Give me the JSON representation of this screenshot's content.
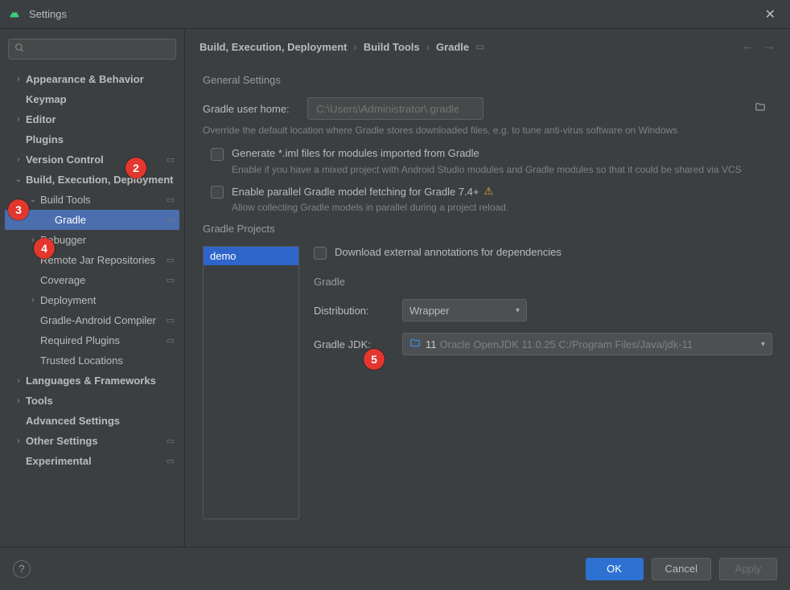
{
  "window": {
    "title": "Settings"
  },
  "search": {
    "placeholder": ""
  },
  "sidebar": {
    "items": [
      {
        "label": "Appearance & Behavior",
        "expandable": true,
        "expanded": false,
        "bold": true,
        "indent": 0
      },
      {
        "label": "Keymap",
        "expandable": false,
        "bold": true,
        "indent": 0
      },
      {
        "label": "Editor",
        "expandable": true,
        "expanded": false,
        "bold": true,
        "indent": 0
      },
      {
        "label": "Plugins",
        "expandable": false,
        "bold": true,
        "indent": 0
      },
      {
        "label": "Version Control",
        "expandable": true,
        "expanded": false,
        "bold": true,
        "indent": 0,
        "proj": true
      },
      {
        "label": "Build, Execution, Deployment",
        "expandable": true,
        "expanded": true,
        "bold": true,
        "indent": 0
      },
      {
        "label": "Build Tools",
        "expandable": true,
        "expanded": true,
        "bold": false,
        "indent": 1,
        "proj": true
      },
      {
        "label": "Gradle",
        "expandable": false,
        "bold": false,
        "indent": 2,
        "proj": true,
        "selected": true
      },
      {
        "label": "Debugger",
        "expandable": true,
        "expanded": false,
        "bold": false,
        "indent": 1
      },
      {
        "label": "Remote Jar Repositories",
        "expandable": false,
        "bold": false,
        "indent": 1,
        "proj": true
      },
      {
        "label": "Coverage",
        "expandable": false,
        "bold": false,
        "indent": 1,
        "proj": true
      },
      {
        "label": "Deployment",
        "expandable": true,
        "expanded": false,
        "bold": false,
        "indent": 1
      },
      {
        "label": "Gradle-Android Compiler",
        "expandable": false,
        "bold": false,
        "indent": 1,
        "proj": true
      },
      {
        "label": "Required Plugins",
        "expandable": false,
        "bold": false,
        "indent": 1,
        "proj": true
      },
      {
        "label": "Trusted Locations",
        "expandable": false,
        "bold": false,
        "indent": 1
      },
      {
        "label": "Languages & Frameworks",
        "expandable": true,
        "expanded": false,
        "bold": true,
        "indent": 0
      },
      {
        "label": "Tools",
        "expandable": true,
        "expanded": false,
        "bold": true,
        "indent": 0
      },
      {
        "label": "Advanced Settings",
        "expandable": false,
        "bold": true,
        "indent": 0
      },
      {
        "label": "Other Settings",
        "expandable": true,
        "expanded": false,
        "bold": true,
        "indent": 0,
        "proj": true
      },
      {
        "label": "Experimental",
        "expandable": false,
        "bold": true,
        "indent": 0,
        "proj": true
      }
    ]
  },
  "breadcrumb": {
    "items": [
      "Build, Execution, Deployment",
      "Build Tools",
      "Gradle"
    ]
  },
  "general": {
    "heading": "General Settings",
    "user_home_label": "Gradle user home:",
    "user_home_placeholder": "C:\\Users\\Administrator\\.gradle",
    "user_home_hint": "Override the default location where Gradle stores downloaded files, e.g. to tune anti-virus software on Windows",
    "iml_label": "Generate *.iml files for modules imported from Gradle",
    "iml_hint": "Enable if you have a mixed project with Android Studio modules and Gradle modules so that it could be shared via VCS",
    "parallel_label": "Enable parallel Gradle model fetching for Gradle 7.4+",
    "parallel_hint": "Allow collecting Gradle models in parallel during a project reload."
  },
  "projects": {
    "heading": "Gradle Projects",
    "list": [
      "demo"
    ],
    "download_annotations_label": "Download external annotations for dependencies",
    "gradle_heading": "Gradle",
    "distribution_label": "Distribution:",
    "distribution_value": "Wrapper",
    "jdk_label": "Gradle JDK:",
    "jdk_number": "11",
    "jdk_detail": "Oracle OpenJDK 11.0.25 C:/Program Files/Java/jdk-11"
  },
  "footer": {
    "ok": "OK",
    "cancel": "Cancel",
    "apply": "Apply"
  },
  "callouts": {
    "c2": "2",
    "c3": "3",
    "c4": "4",
    "c5": "5"
  }
}
